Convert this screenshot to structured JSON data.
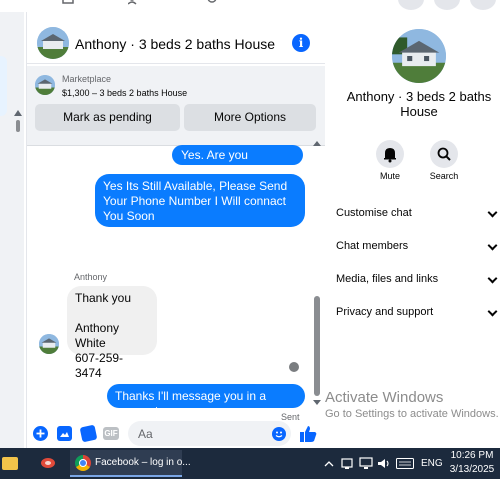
{
  "chat": {
    "title": "Anthony · 3 beds 2 baths House",
    "info_icon": "i"
  },
  "marketplace": {
    "label": "Marketplace",
    "item": "$1,300 – 3 beds 2 baths House",
    "mark_pending": "Mark as pending",
    "more_options": "More Options"
  },
  "messages": {
    "m1": "Yes. Are you interested?",
    "m2": "Yes Its Still Available, Please Send Your Phone Number I Will connact You Soon",
    "sender": "Anthony",
    "m3_line1": "Thank you",
    "m3_line2": "Anthony White",
    "m3_line3": "607-259-3474",
    "m4": "Thanks I'll message you in a moment",
    "status": "Sent"
  },
  "composer": {
    "placeholder": "Aa",
    "gif_label": "GIF"
  },
  "panel": {
    "title": "Anthony · 3 beds 2 baths House",
    "mute_label": "Mute",
    "search_label": "Search",
    "rows": [
      "Customise chat",
      "Chat members",
      "Media, files and links",
      "Privacy and support"
    ]
  },
  "watermark": {
    "line1": "Activate Windows",
    "line2": "Go to Settings to activate Windows."
  },
  "taskbar": {
    "chrome_label": "Facebook – log in o...",
    "lang": "ENG",
    "time": "10:26 PM",
    "date": "3/13/2025"
  },
  "colors": {
    "accent": "#0a7cff",
    "taskbar": "#1c2a3d"
  }
}
